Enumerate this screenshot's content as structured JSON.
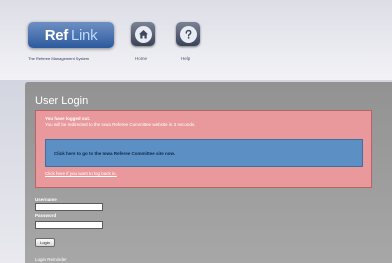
{
  "header": {
    "logo": {
      "ref": "Ref",
      "link": "Link"
    },
    "tagline": "The Referee Management System",
    "nav": {
      "home_label": "Home",
      "help_label": "Help"
    }
  },
  "panel": {
    "title": "User Login",
    "alert": {
      "line1": "You have logged out.",
      "line2": "You will be redirected to the Iowa Referee Committee website in 3 seconds.",
      "redirect_link": "Click here to go to the Iowa Referee Committee site now.",
      "login_link": "Click here if you want to log back in."
    },
    "form": {
      "username_label": "Username",
      "username_value": "",
      "password_label": "Password",
      "password_value": "",
      "login_button": "Login",
      "footer_text": "Login Reminder"
    }
  },
  "colors": {
    "logo_blue": "#2c5a9e",
    "alert_red": "#e9999c",
    "link_box_blue": "#5c8fc3",
    "panel_gray": "#9a9a9a"
  },
  "icons": {
    "home": "home-icon",
    "help": "help-icon"
  }
}
